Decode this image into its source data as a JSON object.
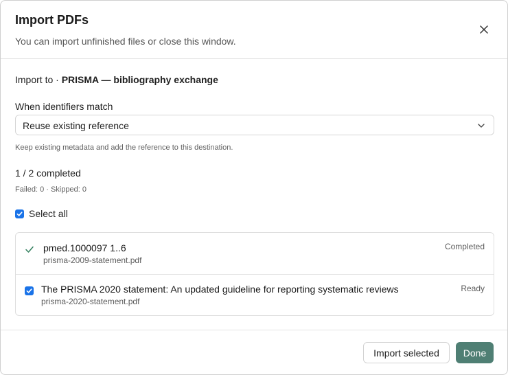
{
  "dialog": {
    "title": "Import PDFs",
    "subtitle": "You can import unfinished files or close this window.",
    "close_icon": "close-icon"
  },
  "import_to": {
    "prefix": "Import to · ",
    "destination": "PRISMA — bibliography exchange"
  },
  "identifier_match": {
    "label": "When identifiers match",
    "selected": "Reuse existing reference",
    "help": "Keep existing metadata and add the reference to this destination."
  },
  "progress": {
    "summary": "1 / 2 completed",
    "counts": "Failed: 0 · Skipped: 0"
  },
  "select_all": {
    "label": "Select all",
    "checked": true
  },
  "files": [
    {
      "name": "pmed.1000097 1..6",
      "file": "prisma-2009-statement.pdf",
      "status": "Completed",
      "icon": "check-icon"
    },
    {
      "name": "The PRISMA 2020 statement: An updated guideline for reporting systematic reviews",
      "file": "prisma-2020-statement.pdf",
      "status": "Ready",
      "checked": true
    }
  ],
  "footer": {
    "import_selected": "Import selected",
    "done": "Done"
  },
  "colors": {
    "primary": "#4f7f74",
    "checkbox": "#1a73e8",
    "success_check": "#2e7d5b"
  }
}
